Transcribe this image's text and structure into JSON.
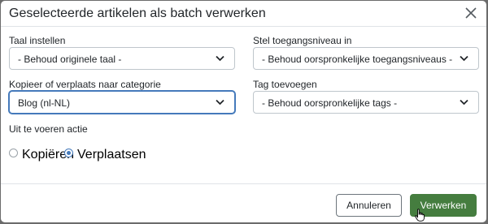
{
  "dialog": {
    "title": "Geselecteerde artikelen als batch verwerken",
    "close_icon": "close-icon"
  },
  "fields": {
    "language": {
      "label": "Taal instellen",
      "value": "- Behoud originele taal -"
    },
    "access": {
      "label": "Stel toegangsniveau in",
      "value": "- Behoud oorspronkelijke toegangsniveaus -"
    },
    "category": {
      "label": "Kopieer of verplaats naar categorie",
      "value": "Blog (nl-NL)"
    },
    "tag": {
      "label": "Tag toevoegen",
      "value": "- Behoud oorspronkelijke tags -"
    }
  },
  "action": {
    "label": "Uit te voeren actie",
    "options": [
      {
        "label": "Kopiëren",
        "selected": false
      },
      {
        "label": "Verplaatsen",
        "selected": true
      }
    ]
  },
  "footer": {
    "cancel_label": "Annuleren",
    "submit_label": "Verwerken"
  },
  "colors": {
    "primary": "#457abb",
    "success": "#457d3f"
  }
}
